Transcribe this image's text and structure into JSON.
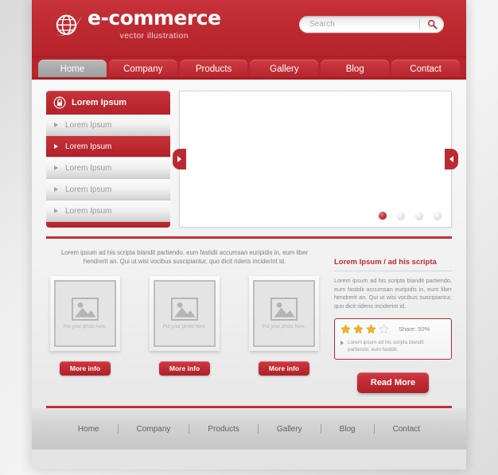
{
  "header": {
    "logo_title": "e-commerce",
    "logo_sub": "vector illustration",
    "logo_icon": "globe-icon",
    "search_placeholder": "Search",
    "search_value": "",
    "search_icon": "search-icon"
  },
  "nav": {
    "tabs": [
      {
        "label": "Home",
        "active": true
      },
      {
        "label": "Company",
        "active": false
      },
      {
        "label": "Products",
        "active": false
      },
      {
        "label": "Gallery",
        "active": false
      },
      {
        "label": "Blog",
        "active": false
      },
      {
        "label": "Contact",
        "active": false
      }
    ]
  },
  "sidebar": {
    "header_label": "Lorem Ipsum",
    "header_icon": "lock-icon",
    "items": [
      {
        "label": "Lorem Ipsum",
        "active": false
      },
      {
        "label": "Lorem Ipsum",
        "active": true
      },
      {
        "label": "Lorem Ipsum",
        "active": false
      },
      {
        "label": "Lorem Ipsum",
        "active": false
      },
      {
        "label": "Lorem Ipsum",
        "active": false
      }
    ]
  },
  "slider": {
    "prev_icon": "chevron-left-icon",
    "next_icon": "chevron-right-icon",
    "dots": [
      {
        "active": true
      },
      {
        "active": false
      },
      {
        "active": false
      },
      {
        "active": false
      }
    ]
  },
  "content": {
    "intro": "Lorem ipsum ad his scripta blandit partiendo, eum fastidii accumsan euripidis in, eum liber hendrerit an. Qui ut wisi vocibus suscipiantur, quo dicit ridens inciderint id.",
    "cards": [
      {
        "placeholder": "Put your photo here.",
        "button": "More info",
        "icon": "image-placeholder-icon"
      },
      {
        "placeholder": "Put your photo here.",
        "button": "More info",
        "icon": "image-placeholder-icon"
      },
      {
        "placeholder": "Put your photo here.",
        "button": "More info",
        "icon": "image-placeholder-icon"
      }
    ]
  },
  "aside": {
    "title": "Lorem Ipsum / ad his scripta",
    "paragraph": "Lorem ipsum ad his scripta blandit partiendo, eum fastidii accumsan euripidis in, eum liber hendrerit an. Qui ut wisi vocibus suscipiantur, quo dicit ridens inciderint id.",
    "rating": {
      "filled": 3,
      "total": 4,
      "share_label": "Share: 50%",
      "note": "Lorem ipsum ad his scripta blandit partiendo, eum fastidii."
    },
    "read_more": "Read More"
  },
  "footer": {
    "links": [
      "Home",
      "Company",
      "Products",
      "Gallery",
      "Blog",
      "Contact"
    ]
  },
  "colors": {
    "brand_red": "#bd2930",
    "brand_red_dark": "#a81d25",
    "active_tab_gray": "#a8a8a8",
    "star_gold": "#f0b323",
    "text_gray": "#8a8a8a"
  }
}
